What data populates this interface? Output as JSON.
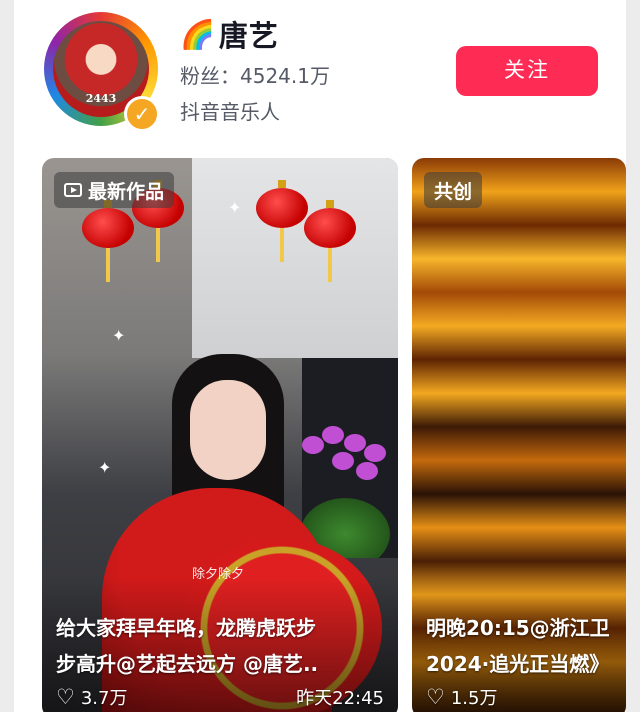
{
  "profile": {
    "name": "唐艺",
    "name_emoji": "🌈",
    "fans_label": "粉丝：",
    "fans_count": "4524.1万",
    "role": "抖音音乐人",
    "avatar_number": "2443",
    "follow_label": "关注"
  },
  "cards": [
    {
      "tag": "最新作品",
      "overlay_caption": "除夕除夕",
      "title_line1": "给大家拜早年咯，龙腾虎跃步",
      "title_line2": "步高升@艺起去远方 @唐艺..",
      "likes": "3.7万",
      "time": "昨天22:45"
    },
    {
      "tag": "共创",
      "title_line1": "明晚20:15@浙江卫",
      "title_line2": "2024·追光正当燃》",
      "likes": "1.5万"
    }
  ],
  "colors": {
    "follow_button": "#fe2c55",
    "verified_badge": "#f5a623"
  }
}
